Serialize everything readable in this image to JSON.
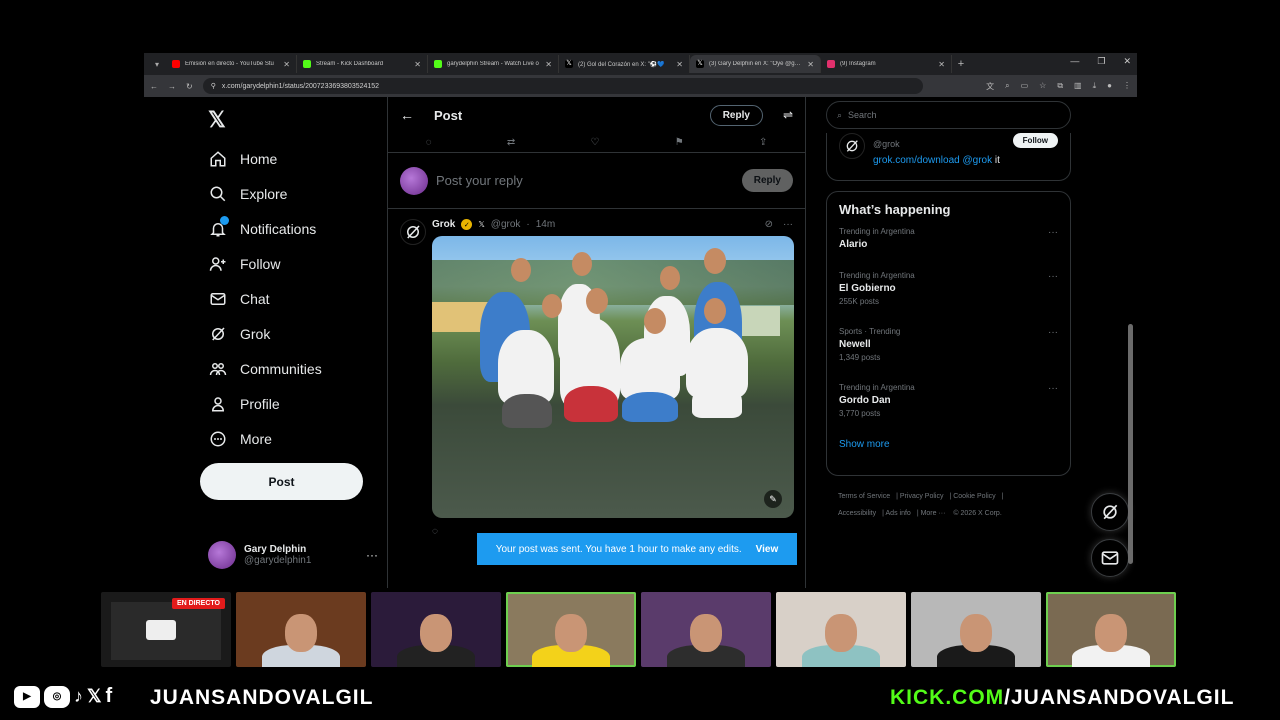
{
  "browser": {
    "tabs": [
      {
        "title": "Emisión en directo - YouTube Stu",
        "color": "#ff0000"
      },
      {
        "title": "Stream - Kick Dashboard",
        "color": "#53fc18"
      },
      {
        "title": "garydelphin Stream - Watch Live o",
        "color": "#53fc18"
      },
      {
        "title": "(2) Gol del Corazón en X: \"⚽💙",
        "color": "#ffffff"
      },
      {
        "title": "(3) Gary Delphin en X: \"Oye @grok",
        "color": "#ffffff"
      },
      {
        "title": "(9) Instagram",
        "color": "#e1306c"
      }
    ],
    "url": "x.com/garydelphin1/status/2007233693803524152"
  },
  "nav": {
    "items": [
      {
        "label": "Home",
        "icon": "home-icon"
      },
      {
        "label": "Explore",
        "icon": "search-icon"
      },
      {
        "label": "Notifications",
        "icon": "bell-icon"
      },
      {
        "label": "Follow",
        "icon": "add-person-icon"
      },
      {
        "label": "Chat",
        "icon": "mail-icon"
      },
      {
        "label": "Grok",
        "icon": "grok-icon"
      },
      {
        "label": "Communities",
        "icon": "people-icon"
      },
      {
        "label": "Profile",
        "icon": "person-icon"
      },
      {
        "label": "More",
        "icon": "more-circle-icon"
      }
    ],
    "post_button": "Post",
    "user": {
      "name": "Gary Delphin",
      "handle": "@garydelphin1"
    }
  },
  "main": {
    "header_title": "Post",
    "reply_pill": "Reply",
    "compose_placeholder": "Post your reply",
    "compose_button": "Reply",
    "tweet": {
      "author": "Grok",
      "handle": "@grok",
      "time": "14m"
    },
    "toast": {
      "text": "Your post was sent. You have 1 hour to make any edits.",
      "action": "View"
    }
  },
  "sidebar": {
    "search_placeholder": "Search",
    "grok_card": {
      "handle": "@grok",
      "follow": "Follow",
      "link": "grok.com/download @grok",
      "suffix": "it"
    },
    "happening_title": "What’s happening",
    "trends": [
      {
        "context": "Trending in Argentina",
        "name": "Alario",
        "count": ""
      },
      {
        "context": "Trending in Argentina",
        "name": "El Gobierno",
        "count": "255K posts"
      },
      {
        "context": "Sports · Trending",
        "name": "Newell",
        "count": "1,349 posts"
      },
      {
        "context": "Trending in Argentina",
        "name": "Gordo Dan",
        "count": "3,770 posts"
      }
    ],
    "show_more": "Show more",
    "footer": [
      "Terms of Service",
      "Privacy Policy",
      "Cookie Policy",
      "Accessibility",
      "Ads info",
      "More ···",
      "© 2026 X Corp."
    ]
  },
  "overlay": {
    "live_badge": "EN DIRECTO",
    "handle_left": "JUANSANDOVALGIL",
    "kick_domain": "KICK.COM",
    "handle_right": "/JUANSANDOVALGIL"
  }
}
